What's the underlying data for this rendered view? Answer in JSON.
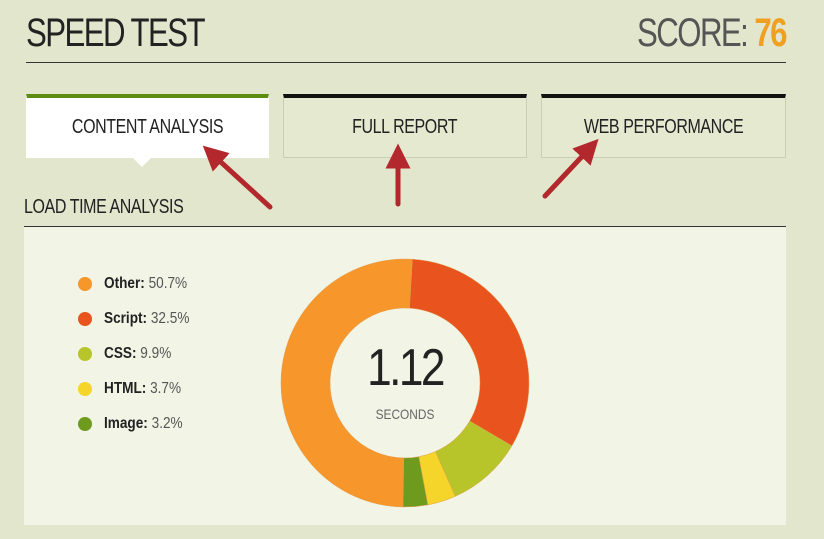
{
  "header": {
    "title": "SPEED TEST",
    "score_label": "SCORE:",
    "score_value": "76"
  },
  "tabs": [
    {
      "label": "CONTENT ANALYSIS",
      "active": true
    },
    {
      "label": "FULL REPORT",
      "active": false
    },
    {
      "label": "WEB PERFORMANCE",
      "active": false
    }
  ],
  "section": {
    "label": "LOAD TIME ANALYSIS"
  },
  "center": {
    "value": "1.12",
    "unit": "SECONDS"
  },
  "legend": [
    {
      "name": "Other:",
      "pct": "50.7%",
      "color": "#f7962a"
    },
    {
      "name": "Script:",
      "pct": "32.5%",
      "color": "#e8531e"
    },
    {
      "name": "CSS:",
      "pct": "9.9%",
      "color": "#b7c52a"
    },
    {
      "name": "HTML:",
      "pct": "3.7%",
      "color": "#f5d52a"
    },
    {
      "name": "Image:",
      "pct": "3.2%",
      "color": "#6e9a1e"
    }
  ],
  "chart_data": {
    "type": "pie",
    "categories": [
      "Other",
      "Script",
      "CSS",
      "HTML",
      "Image"
    ],
    "values": [
      50.7,
      32.5,
      9.9,
      3.7,
      3.2
    ],
    "colors": [
      "#f7962a",
      "#e8531e",
      "#b7c52a",
      "#f5d52a",
      "#6e9a1e"
    ]
  },
  "annotation_color": "#b3282d"
}
